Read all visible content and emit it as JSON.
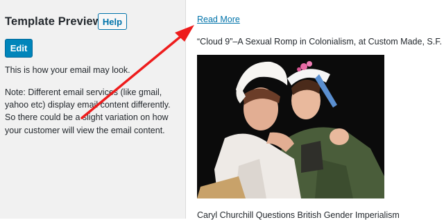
{
  "sidebar": {
    "title": "Template Preview",
    "help_label": "Help",
    "edit_label": "Edit",
    "intro": "This is how your email may look.",
    "note": "Note: Different email services (like gmail, yahoo etc) display email content differently. So there could be a slight variation on how your customer will view the email content."
  },
  "preview": {
    "read_more": "Read More",
    "headline_1": "“Cloud 9”–A Sexual Romp in Colonialism, at Custom Made, S.F.",
    "headline_2": "Caryl Churchill Questions British Gender Imperialism"
  },
  "colors": {
    "accent": "#0073aa",
    "primary_button": "#0085ba",
    "annotation_arrow": "#ee1c1c"
  }
}
